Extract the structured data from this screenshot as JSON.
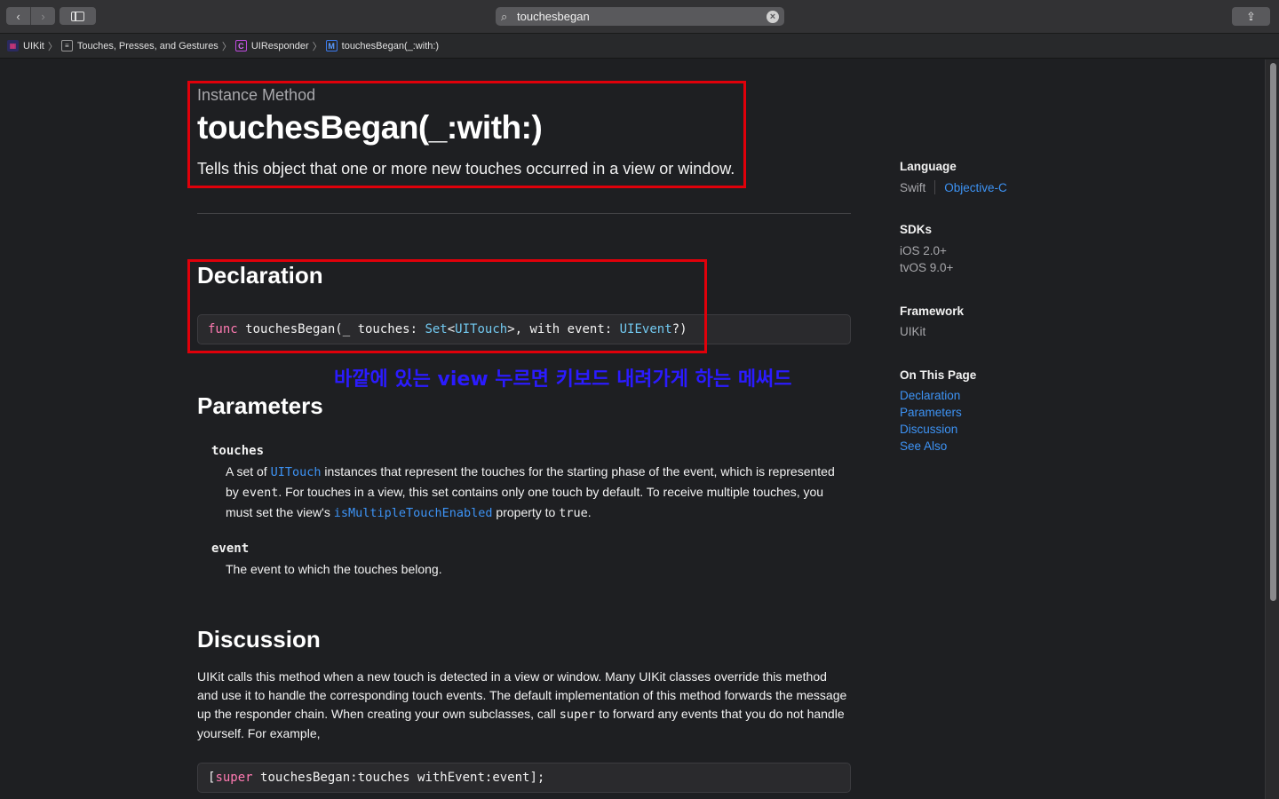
{
  "toolbar": {
    "back_glyph": "‹",
    "forward_glyph": "›",
    "search_value": "touchesbegan",
    "share_glyph": "⇪"
  },
  "breadcrumb": [
    {
      "label": "UIKit",
      "icon": "framework-icon"
    },
    {
      "label": "Touches, Presses, and Gestures",
      "icon": "article-icon"
    },
    {
      "label": "UIResponder",
      "icon": "class-icon",
      "glyph": "C"
    },
    {
      "label": "touchesBegan(_:with:)",
      "icon": "method-icon",
      "glyph": "M"
    }
  ],
  "header": {
    "eyebrow": "Instance Method",
    "title": "touchesBegan(_:with:)",
    "abstract": "Tells this object that one or more new touches occurred in a view or window."
  },
  "declaration": {
    "heading": "Declaration",
    "code": {
      "kw": "func",
      "name": " touchesBegan(_ touches: ",
      "set": "Set",
      "lt": "<",
      "touch": "UITouch",
      "mid": ">, with event: ",
      "event": "UIEvent",
      "end": "?)"
    }
  },
  "annotation_text": "바깥에 있는 view 누르면 키보드 내려가게 하는 메써드",
  "parameters": {
    "heading": "Parameters",
    "items": [
      {
        "name": "touches",
        "desc_1": "A set of ",
        "link_1": "UITouch",
        "desc_2": " instances that represent the touches for the starting phase of the event, which is represented by ",
        "code_1": "event",
        "desc_3": ". For touches in a view, this set contains only one touch by default. To receive multiple touches, you must set the view's ",
        "link_2": "isMultipleTouchEnabled",
        "desc_4": " property to ",
        "code_2": "true",
        "desc_5": "."
      },
      {
        "name": "event",
        "desc": "The event to which the touches belong."
      }
    ]
  },
  "discussion": {
    "heading": "Discussion",
    "text_1": "UIKit calls this method when a new touch is detected in a view or window. Many UIKit classes override this method and use it to handle the corresponding touch events. The default implementation of this method forwards the message up the responder chain. When creating your own subclasses, call ",
    "code_1": "super",
    "text_2": " to forward any events that you do not handle yourself. For example,",
    "example": {
      "open": "[",
      "kw": "super",
      "rest": " touchesBegan:touches withEvent:event];"
    }
  },
  "sidebar": {
    "language_heading": "Language",
    "language_current": "Swift",
    "language_other": "Objective-C",
    "sdks_heading": "SDKs",
    "sdks": [
      "iOS 2.0+",
      "tvOS 9.0+"
    ],
    "framework_heading": "Framework",
    "framework": "UIKit",
    "on_this_page_heading": "On This Page",
    "on_this_page": [
      "Declaration",
      "Parameters",
      "Discussion",
      "See Also"
    ]
  },
  "colors": {
    "background": "#1e1f22",
    "link": "#3d93f5",
    "keyword": "#ff7ab2",
    "type": "#72c9f0",
    "annotation_box": "#e0000a",
    "annotation_text": "#2b1bff"
  }
}
